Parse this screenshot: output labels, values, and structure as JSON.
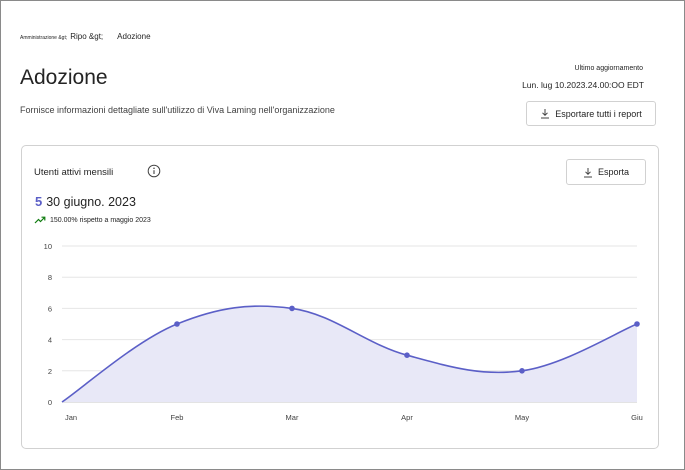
{
  "breadcrumb": {
    "items": [
      "Amministrazione &gt;",
      "Ripo &gt;"
    ],
    "current": "Adozione"
  },
  "header": {
    "title": "Adozione",
    "description": "Fornisce informazioni dettagliate sull'utilizzo di Viva Laming nell'organizzazione",
    "update_label": "Ultimo aggiornamento",
    "update_value": "Lun. lug 10.2023.24.00:OO EDT",
    "export_all_label": "Esportare tutti i report"
  },
  "card": {
    "title": "Utenti attivi mensili",
    "export_label": "Esporta",
    "kpi_value": "5",
    "kpi_date": "30 giugno. 2023",
    "trend_text": "150.00% rispetto a maggio 2023",
    "trend_color": "#107c10"
  },
  "chart_data": {
    "type": "area",
    "categories": [
      "Jan",
      "Feb",
      "Mar",
      "Apr",
      "May",
      "Giu"
    ],
    "values": [
      0,
      5,
      6,
      3,
      2,
      5
    ],
    "ylim": [
      0,
      10
    ],
    "yticks": [
      "0",
      "2",
      "4",
      "6",
      "8",
      "10"
    ],
    "grid": true,
    "line_color": "#5b5fc7",
    "fill_color": "#e8e8f7"
  },
  "icons": {
    "download": "download-icon",
    "info": "info-icon",
    "trend": "trend-up-icon"
  }
}
